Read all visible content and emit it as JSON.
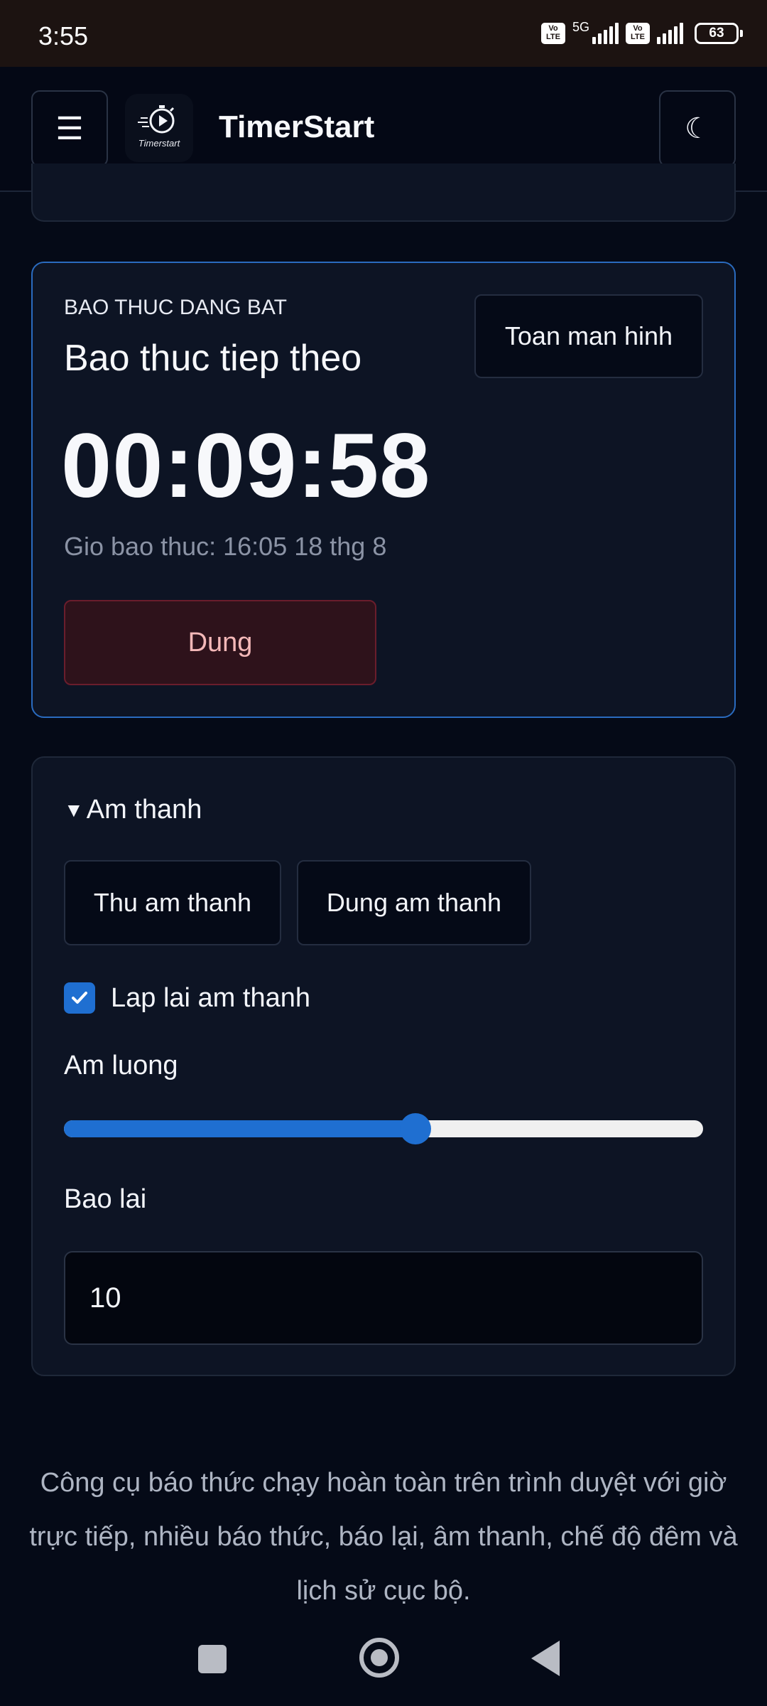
{
  "status_bar": {
    "time": "3:55",
    "volte_1": "Vo LTE",
    "network_label": "5G",
    "volte_2": "Vo LTE",
    "battery_level": "63"
  },
  "app_bar": {
    "title": "TimerStart",
    "logo_label": "Timerstart",
    "menu_icon": "☰",
    "theme_icon": "☾"
  },
  "alarm_card": {
    "eyebrow": "BAO THUC DANG BAT",
    "title": "Bao thuc tiep theo",
    "fullscreen_label": "Toan man hinh",
    "countdown": "00:09:58",
    "alarm_time": "Gio bao thuc: 16:05 18 thg 8",
    "stop_label": "Dung"
  },
  "sound_panel": {
    "summary": "Am thanh",
    "test_label": "Thu am thanh",
    "stop_sound_label": "Dung am thanh",
    "repeat_label": "Lap lai am thanh",
    "repeat_checked": true,
    "volume_label": "Am luong",
    "volume_fraction": 0.55,
    "snooze_label": "Bao lai",
    "snooze_value": "10"
  },
  "footer": {
    "text": "Công cụ báo thức chạy hoàn toàn trên trình duyệt với giờ trực tiếp, nhiều báo thức, báo lại, âm thanh, chế độ đêm và lịch sử cục bộ."
  },
  "colors": {
    "accent": "#1f6fd1",
    "background": "#050a17",
    "card": "#0d1424",
    "danger_bg": "#2e121b",
    "danger_text": "#f4b8b8"
  }
}
